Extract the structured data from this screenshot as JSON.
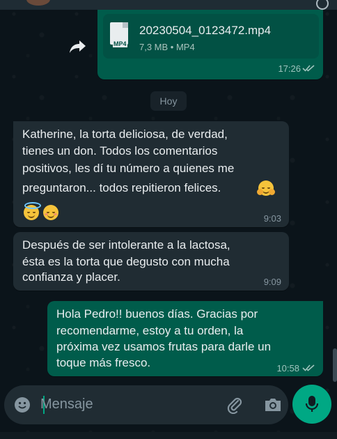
{
  "file_message": {
    "type_badge": "MP4",
    "file_name": "20230504_0123472.mp4",
    "file_meta": "7,3 MB • MP4",
    "time": "17:26"
  },
  "date_divider": "Hoy",
  "messages": [
    {
      "direction": "incoming",
      "lines": [
        "Katherine, la torta deliciosa, de verdad,",
        "tienes un don. Todos los comentarios",
        "positivos, les dí tu número a quienes me",
        "preguntaron... todos repitieron felices."
      ],
      "emojis": [
        "hugging-face",
        "smiling-face-with-halo",
        "smiling-face-with-smiling-eyes"
      ],
      "time": "9:03"
    },
    {
      "direction": "incoming",
      "lines": [
        "Después de ser intolerante a la lactosa,",
        "ésta es la torta que degusto con mucha",
        "confianza y placer."
      ],
      "time": "9:09"
    },
    {
      "direction": "outgoing",
      "lines": [
        "Hola Pedro!!  buenos días. Gracias por",
        "recomendarme, estoy a tu orden, la",
        "próxima vez usamos frutas para darle un",
        "toque más fresco."
      ],
      "time": "10:58",
      "status": "read"
    }
  ],
  "composer": {
    "placeholder": "Mensaje"
  },
  "colors": {
    "outgoing_bubble": "#005c4b",
    "incoming_bubble": "#202c33",
    "accent": "#00a884",
    "read_ticks": "#9ec4bd",
    "background": "#0b141a"
  }
}
